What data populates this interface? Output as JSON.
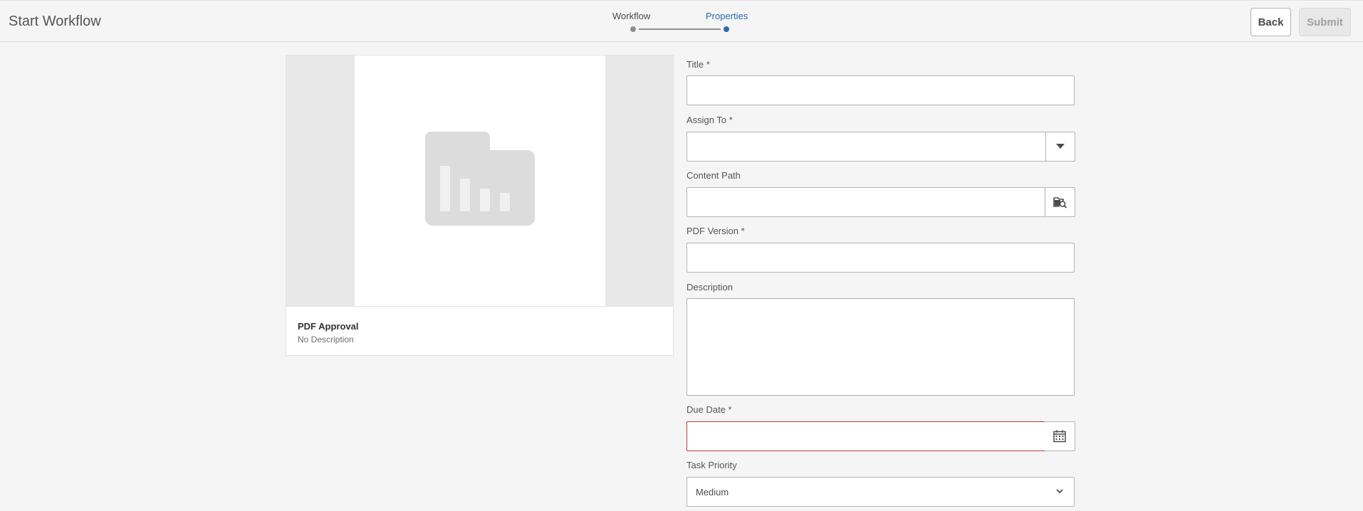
{
  "header": {
    "title": "Start Workflow",
    "steps": [
      {
        "label": "Workflow",
        "state": "completed"
      },
      {
        "label": "Properties",
        "state": "current"
      }
    ],
    "back_label": "Back",
    "submit_label": "Submit"
  },
  "workflow_card": {
    "thumbnail_icon": "folder-chart-icon",
    "title": "PDF Approval",
    "description": "No Description"
  },
  "form": {
    "title": {
      "label": "Title *",
      "value": ""
    },
    "assign_to": {
      "label": "Assign To *",
      "value": "",
      "button_icon": "caret-down-icon"
    },
    "content_path": {
      "label": "Content Path",
      "value": "",
      "button_icon": "folder-search-icon"
    },
    "pdf_version": {
      "label": "PDF Version *",
      "value": ""
    },
    "description": {
      "label": "Description",
      "value": ""
    },
    "due_date": {
      "label": "Due Date *",
      "value": "",
      "button_icon": "calendar-icon",
      "invalid": true
    },
    "task_priority": {
      "label": "Task Priority",
      "value": "Medium",
      "button_icon": "chevron-down-icon"
    }
  },
  "colors": {
    "accent": "#2c6ab1",
    "error": "#c0392b",
    "background": "#f5f5f5"
  }
}
